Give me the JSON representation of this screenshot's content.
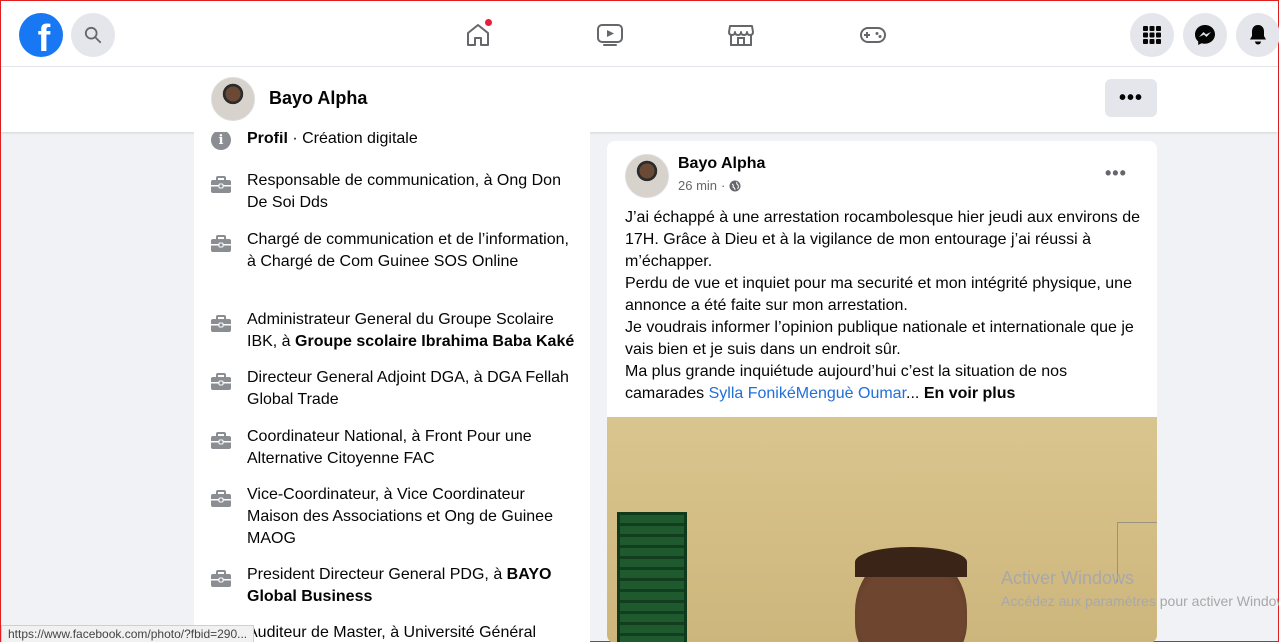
{
  "topnav": {
    "logo": "f",
    "icons": [
      "search-icon",
      "home-icon",
      "watch-icon",
      "marketplace-icon",
      "gaming-icon",
      "menu-grid-icon",
      "messenger-icon",
      "bell-icon"
    ]
  },
  "profile_bar": {
    "name": "Bayo Alpha",
    "more_label": "•••"
  },
  "intro": {
    "profile_label": "Profil",
    "profile_category": " · Création digitale",
    "items": [
      {
        "text": "Responsable de communication, à Ong Don De Soi Dds",
        "bold": ""
      },
      {
        "text": "Chargé de communication et de l’information, à Chargé de Com Guinee SOS Online",
        "bold": ""
      },
      {
        "text": "Administrateur General du Groupe Scolaire IBK, à ",
        "bold": "Groupe scolaire Ibrahima Baba Kaké"
      },
      {
        "text": "Directeur General Adjoint DGA, à DGA Fellah Global Trade",
        "bold": ""
      },
      {
        "text": "Coordinateur National, à Front Pour une Alternative Citoyenne FAC",
        "bold": ""
      },
      {
        "text": "Vice-Coordinateur, à Vice Coordinateur Maison des Associations et Ong de Guinee MAOG",
        "bold": ""
      },
      {
        "text": "President Directeur General PDG, à ",
        "bold": "BAYO Global Business"
      },
      {
        "text": "Auditeur de Master, à Université Général",
        "bold": ""
      }
    ]
  },
  "post": {
    "author": "Bayo Alpha",
    "time": "26 min",
    "time_sep": " · ",
    "more_label": "•••",
    "para1": "J’ai échappé à une arrestation rocambolesque hier jeudi aux environs de 17H. Grâce à Dieu et à la vigilance de mon entourage j’ai réussi à m’échapper.",
    "para2": "Perdu de vue et inquiet pour ma securité et mon intégrité physique, une annonce a été faite sur mon arrestation.",
    "para3": "Je voudrais informer l’opinion publique nationale et internationale que je vais bien et je suis dans un endroit sûr.",
    "para4": "Ma plus grande inquiétude aujourd’hui c’est la situation de nos camarades ",
    "tags": "Sylla FonikéMenguè Oumar",
    "ellipsis": "... ",
    "see_more": "En voir plus"
  },
  "watermark": {
    "title": "Activer Windows",
    "subtitle": "Accédez aux paramètres pour activer Windows."
  },
  "status_url": "https://www.facebook.com/photo/?fbid=290..."
}
